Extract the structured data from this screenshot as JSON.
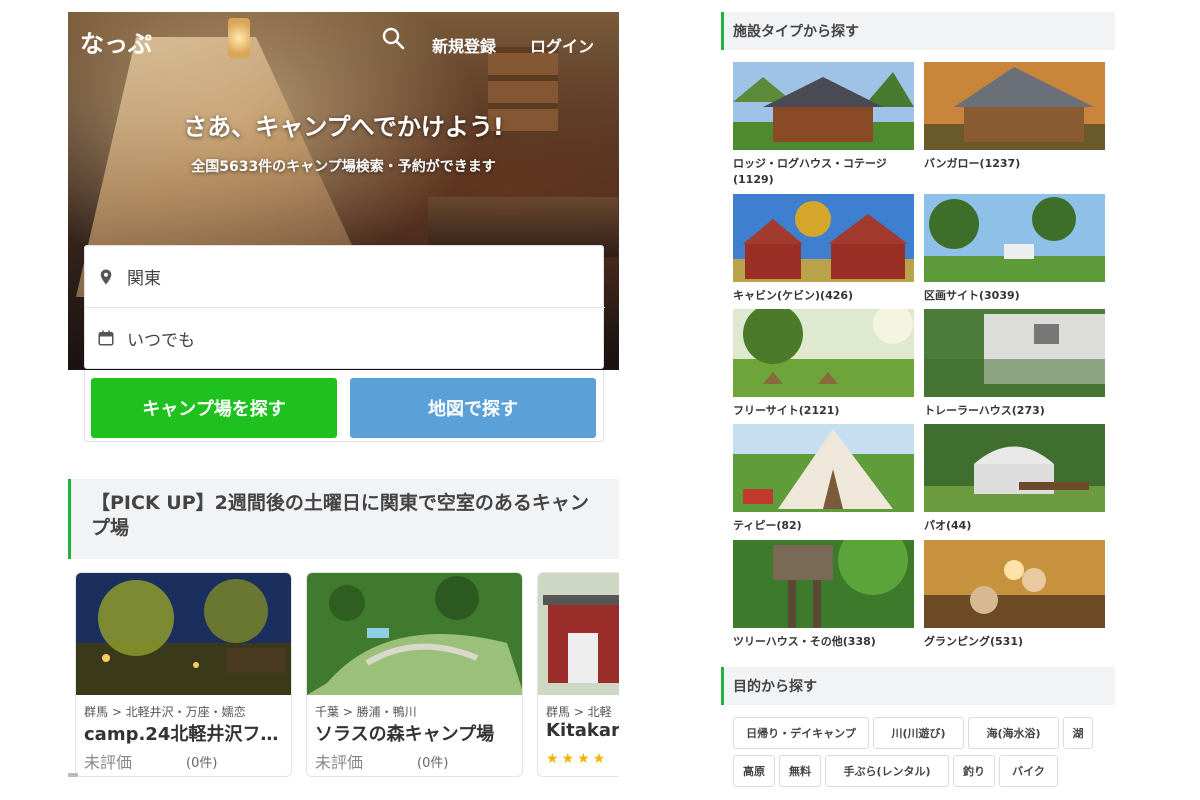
{
  "header": {
    "logo": "なっぷ",
    "register": "新規登録",
    "login": "ログイン"
  },
  "hero": {
    "title": "さあ、キャンプへでかけよう!",
    "subtitle": "全国5633件のキャンプ場検索・予約ができます"
  },
  "search": {
    "area": "関東",
    "date": "いつでも",
    "search_button": "キャンプ場を探す",
    "map_button": "地図で探す"
  },
  "pickup": {
    "heading": "【PICK UP】2週間後の土曜日に関東で空室のあるキャンプ場"
  },
  "cards": [
    {
      "area": "群馬 > 北軽井沢・万座・嬬恋",
      "name": "camp.24北軽井沢フ…",
      "rating": "未評価",
      "count": "(0件)"
    },
    {
      "area": "千葉 > 勝浦・鴨川",
      "name": "ソラスの森キャンプ場",
      "rating": "未評価",
      "count": "(0件)"
    },
    {
      "area": "群馬 > 北軽",
      "name": "Kitakar",
      "stars": "★★★★"
    }
  ],
  "facility": {
    "heading": "施設タイプから探す",
    "items": [
      {
        "label": "ロッジ・ログハウス・コテージ(1129)"
      },
      {
        "label": "バンガロー(1237)"
      },
      {
        "label": "キャビン(ケビン)(426)"
      },
      {
        "label": "区画サイト(3039)"
      },
      {
        "label": "フリーサイト(2121)"
      },
      {
        "label": "トレーラーハウス(273)"
      },
      {
        "label": "ティピー(82)"
      },
      {
        "label": "パオ(44)"
      },
      {
        "label": "ツリーハウス・その他(338)"
      },
      {
        "label": "グランピング(531)"
      }
    ]
  },
  "purpose": {
    "heading": "目的から探す",
    "tags": [
      "日帰り・デイキャンプ",
      "川(川遊び)",
      "海(海水浴)",
      "湖",
      "高原",
      "無料",
      "手ぶら(レンタル)",
      "釣り",
      "バイク"
    ]
  },
  "colors": {
    "accent_green": "#1ec11e",
    "map_blue": "#5aa1d9",
    "section_bar": "#22b33a"
  }
}
